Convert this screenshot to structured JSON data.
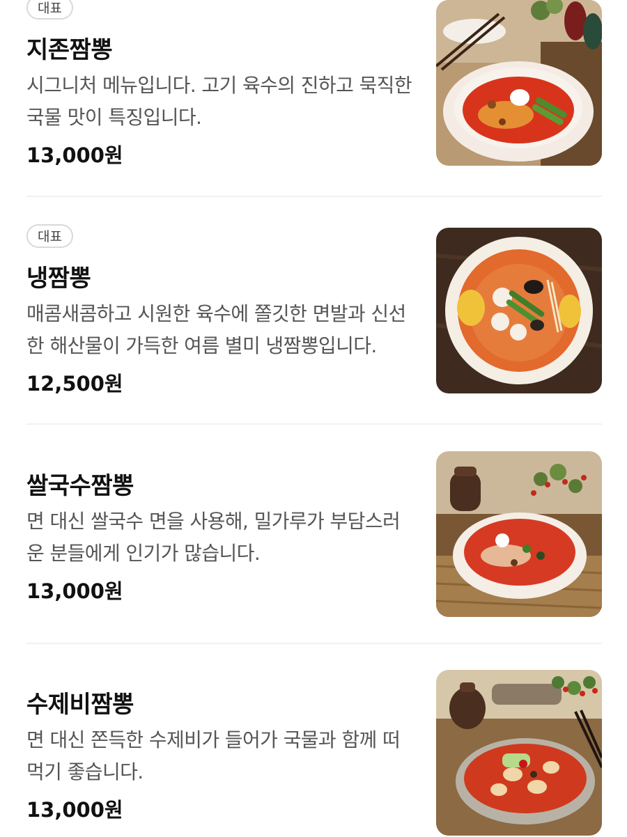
{
  "menu": {
    "items": [
      {
        "badge": "대표",
        "name": "지존짬뽕",
        "description": "시그니처 메뉴입니다. 고기 육수의 진하고 묵직한 국물 맛이 특징입니다.",
        "price": "13,000원",
        "image": "jjamppong-bowl-photo"
      },
      {
        "badge": "대표",
        "name": "냉짬뽕",
        "description": "매콤새콤하고 시원한 육수에 쫄깃한 면발과 신선한 해산물이 가득한 여름 별미 냉짬뽕입니다.",
        "price": "12,500원",
        "image": "cold-jjamppong-bowl-photo"
      },
      {
        "name": "쌀국수짬뽕",
        "description": "면 대신 쌀국수 면을 사용해, 밀가루가 부담스러운 분들에게 인기가 많습니다.",
        "price": "13,000원",
        "image": "rice-noodle-jjamppong-photo"
      },
      {
        "name": "수제비짬뽕",
        "description": "면 대신 쫀득한 수제비가 들어가 국물과 함께 떠먹기 좋습니다.",
        "price": "13,000원",
        "image": "sujebi-jjamppong-photo"
      }
    ]
  },
  "colors": {
    "background": "#ffffff",
    "text_primary": "#111111",
    "text_secondary": "#555555",
    "badge_border": "#d9d9d9",
    "divider": "#f1f1f1",
    "soup_red": "#d8341c"
  }
}
